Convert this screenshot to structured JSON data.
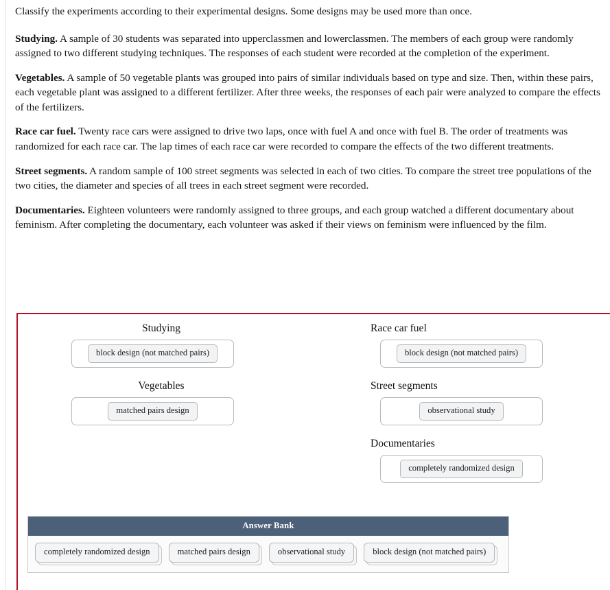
{
  "prose": {
    "intro": "Classify the experiments according to their experimental designs. Some designs may be used more than once.",
    "paragraphs": [
      {
        "term": "Studying.",
        "text": " A sample of 30 students was separated into upperclassmen and lowerclassmen. The members of each group were randomly assigned to two different studying techniques. The responses of each student were recorded at the completion of the experiment."
      },
      {
        "term": "Vegetables.",
        "text": " A sample of 50 vegetable plants was grouped into pairs of similar individuals based on type and size. Then, within these pairs, each vegetable plant was assigned to a different fertilizer. After three weeks, the responses of each pair were analyzed to compare the effects of the fertilizers."
      },
      {
        "term": "Race car fuel.",
        "text": " Twenty race cars were assigned to drive two laps, once with fuel A and once with fuel B. The order of treatments was randomized for each race car. The lap times of each race car were recorded to compare the effects of the two different treatments."
      },
      {
        "term": "Street segments.",
        "text": " A random sample of 100 street segments was selected in each of two cities. To compare the street tree populations of the two cities, the diameter and species of all trees in each street segment were recorded."
      },
      {
        "term": "Documentaries.",
        "text": " Eighteen volunteers were randomly assigned to three groups, and each group watched a different documentary about feminism. After completing the documentary, each volunteer was asked if their views on feminism were influenced by the film."
      }
    ]
  },
  "exercise": {
    "columns": {
      "left": [
        {
          "label": "Studying",
          "placed": "block design (not matched pairs)"
        },
        {
          "label": "Vegetables",
          "placed": "matched pairs design"
        }
      ],
      "right": [
        {
          "label": "Race car fuel",
          "placed": "block design (not matched pairs)"
        },
        {
          "label": "Street segments",
          "placed": "observational study"
        },
        {
          "label": "Documentaries",
          "placed": "completely randomized design"
        }
      ]
    },
    "answer_bank": {
      "title": "Answer Bank",
      "tiles": [
        "completely randomized design",
        "matched pairs design",
        "observational study",
        "block design (not matched pairs)"
      ]
    }
  },
  "colors": {
    "accent_border": "#b5122a",
    "answer_bank_header": "#4d6079",
    "tile_face": "#f2f3f5",
    "tile_border": "#b7b7b7"
  }
}
